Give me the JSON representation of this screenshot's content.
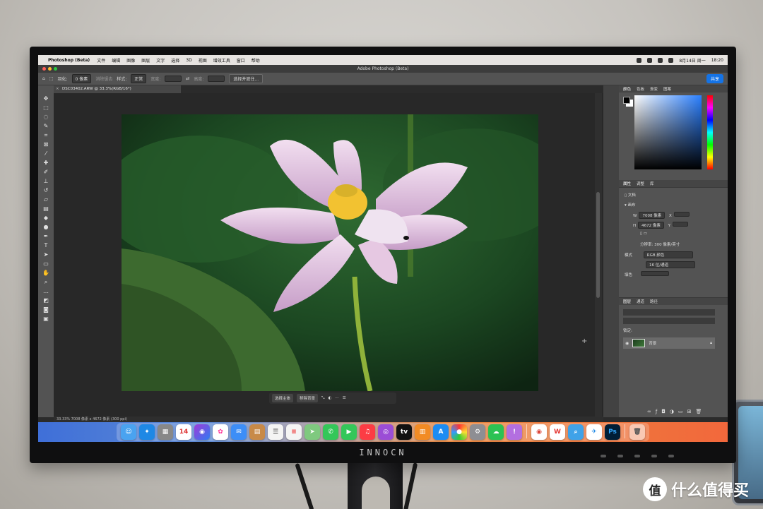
{
  "menubar": {
    "app": "Photoshop (Beta)",
    "menus": [
      "文件",
      "编辑",
      "图像",
      "图层",
      "文字",
      "选择",
      "3D",
      "视图",
      "增效工具",
      "窗口",
      "帮助"
    ],
    "date": "8月14日 周一",
    "time": "18:20"
  },
  "window": {
    "title": "Adobe Photoshop (Beta)"
  },
  "options": {
    "feather_label": "羽化:",
    "feather_value": "0 像素",
    "antialias": "消除锯齿",
    "style_label": "样式:",
    "style_value": "正常",
    "width_label": "宽度:",
    "height_label": "高度:",
    "select_mask": "选择并遮住...",
    "share": "共享"
  },
  "document": {
    "tab": "DSC03402.ARW @ 33.3%(RGB/16*)",
    "status": "33.33%   7008 像素 x 4672 像素 (300 ppi)"
  },
  "context_bar": {
    "select_subject": "选择主体",
    "remove_bg": "移除背景"
  },
  "panels": {
    "color_tabs": [
      "颜色",
      "色板",
      "渐变",
      "图案"
    ],
    "props_tabs": [
      "属性",
      "调整",
      "库"
    ],
    "doc_label": "文档",
    "canvas_label": "画布",
    "w_label": "W",
    "w_value": "7008 像素",
    "x_label": "X",
    "h_label": "H",
    "h_value": "4672 像素",
    "y_label": "Y",
    "resolution": "分辨率: 300 像素/英寸",
    "mode_label": "模式",
    "mode_value": "RGB 颜色",
    "depth_value": "16 位/通道",
    "fill_label": "填色",
    "layer_tabs": [
      "图层",
      "通道",
      "路径"
    ],
    "lock_label": "锁定:",
    "layer_name": "背景"
  },
  "dock": {
    "calendar_day": "14",
    "ps_label": "Ps",
    "icons": [
      "finder-icon",
      "safari-icon",
      "launchpad-icon",
      "calendar-icon",
      "siri-icon",
      "photos-icon",
      "mail-icon",
      "notes-icon",
      "reminders-icon",
      "maps-icon",
      "messages-icon",
      "facetime-icon",
      "music-icon",
      "podcasts-icon",
      "appletv-icon",
      "books-icon",
      "appstore-icon",
      "settings-icon",
      "wechat-icon",
      "chrome-icon",
      "wps-icon",
      "preview-icon",
      "photoshop-icon",
      "trash-icon"
    ]
  },
  "monitor": {
    "brand": "INNOCN"
  },
  "watermark": {
    "text": "什么值得买",
    "logo": "值"
  },
  "colors": {
    "accent": "#1473e6",
    "ps_panel": "#535353",
    "ps_dark": "#282828",
    "leaf_green": "#2f6b32",
    "petal_pink": "#e9c9e4",
    "stamen_yellow": "#f2c231"
  }
}
